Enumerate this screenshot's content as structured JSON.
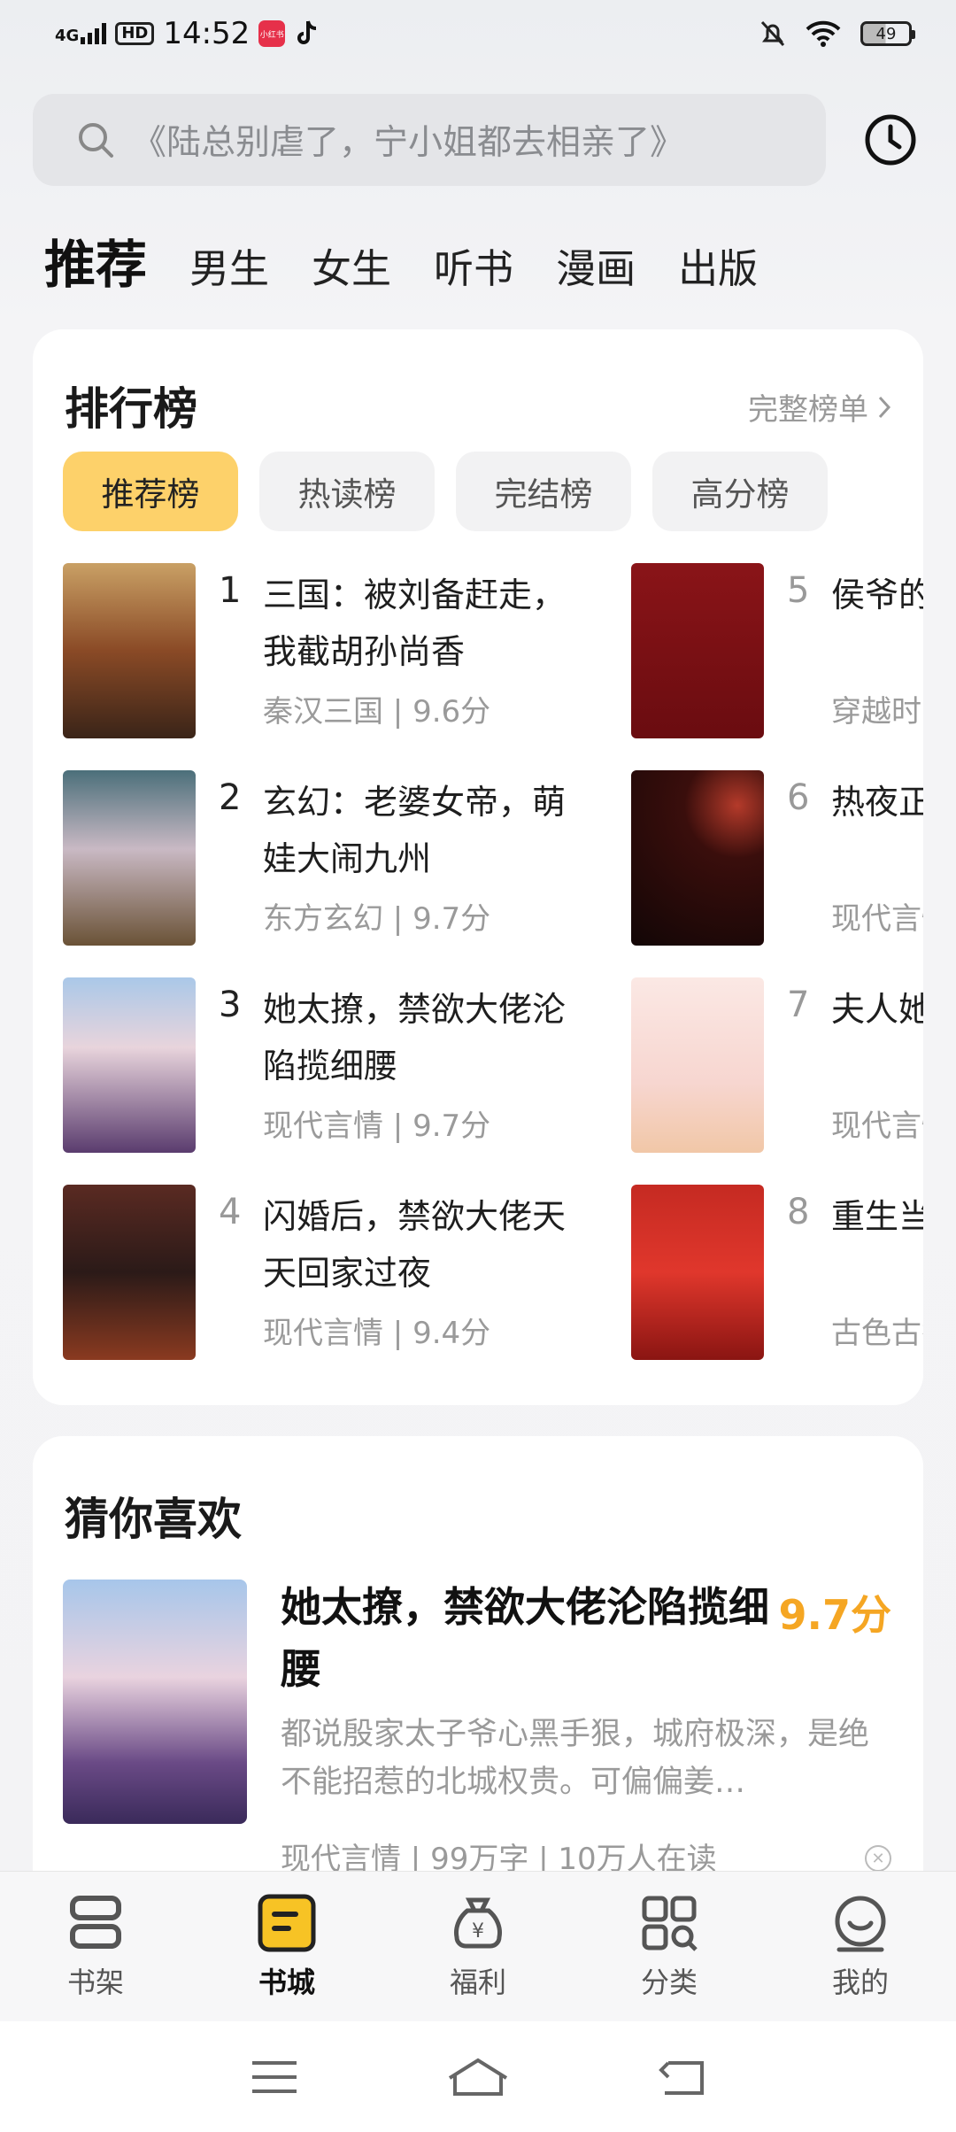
{
  "status_bar": {
    "network": "4G",
    "hd": "HD",
    "time": "14:52",
    "app_badge": "小红书",
    "battery": "49"
  },
  "search": {
    "placeholder": "《陆总别虐了，宁小姐都去相亲了》"
  },
  "tabs": [
    {
      "label": "推荐",
      "active": true
    },
    {
      "label": "男生"
    },
    {
      "label": "女生"
    },
    {
      "label": "听书"
    },
    {
      "label": "漫画"
    },
    {
      "label": "出版"
    }
  ],
  "ranking": {
    "title": "排行榜",
    "more": "完整榜单",
    "pills": [
      "推荐榜",
      "热读榜",
      "完结榜",
      "高分榜"
    ],
    "items": [
      {
        "rank": "1",
        "title": "三国：被刘备赶走，我截胡孙尚香",
        "meta": "秦汉三国 | 9.6分"
      },
      {
        "rank": "2",
        "title": "玄幻：老婆女帝，萌娃大闹九州",
        "meta": "东方玄幻 | 9.7分"
      },
      {
        "rank": "3",
        "title": "她太撩，禁欲大佬沦陷揽细腰",
        "meta": "现代言情 | 9.7分"
      },
      {
        "rank": "4",
        "title": "闪婚后，禁欲大佬天天回家过夜",
        "meta": "现代言情 | 9.4分"
      },
      {
        "rank": "5",
        "title": "侯爷的黑心莲",
        "meta": "穿越时空"
      },
      {
        "rank": "6",
        "title": "热夜正浓",
        "meta": "现代言情"
      },
      {
        "rank": "7",
        "title": "夫人她竟是全能大佬",
        "meta": "现代言情"
      },
      {
        "rank": "8",
        "title": "重生当男嫁纨绔",
        "meta": "古色古香"
      }
    ]
  },
  "recommend": {
    "title": "猜你喜欢",
    "book_title": "她太撩，禁欲大佬沦陷揽细腰",
    "score": "9.7分",
    "desc": "都说殷家太子爷心黑手狠，城府极深，是绝不能招惹的北城权贵。可偏偏姜…",
    "meta": "现代言情 | 99万字 | 10万人在读"
  },
  "bottom_nav": [
    {
      "label": "书架",
      "icon": "bookshelf-icon"
    },
    {
      "label": "书城",
      "icon": "bookstore-icon",
      "active": true
    },
    {
      "label": "福利",
      "icon": "welfare-bag-icon"
    },
    {
      "label": "分类",
      "icon": "category-icon"
    },
    {
      "label": "我的",
      "icon": "profile-icon"
    }
  ],
  "colors": {
    "accent": "#fdd16a",
    "score": "#f5a623",
    "active_nav": "#f7c325"
  }
}
